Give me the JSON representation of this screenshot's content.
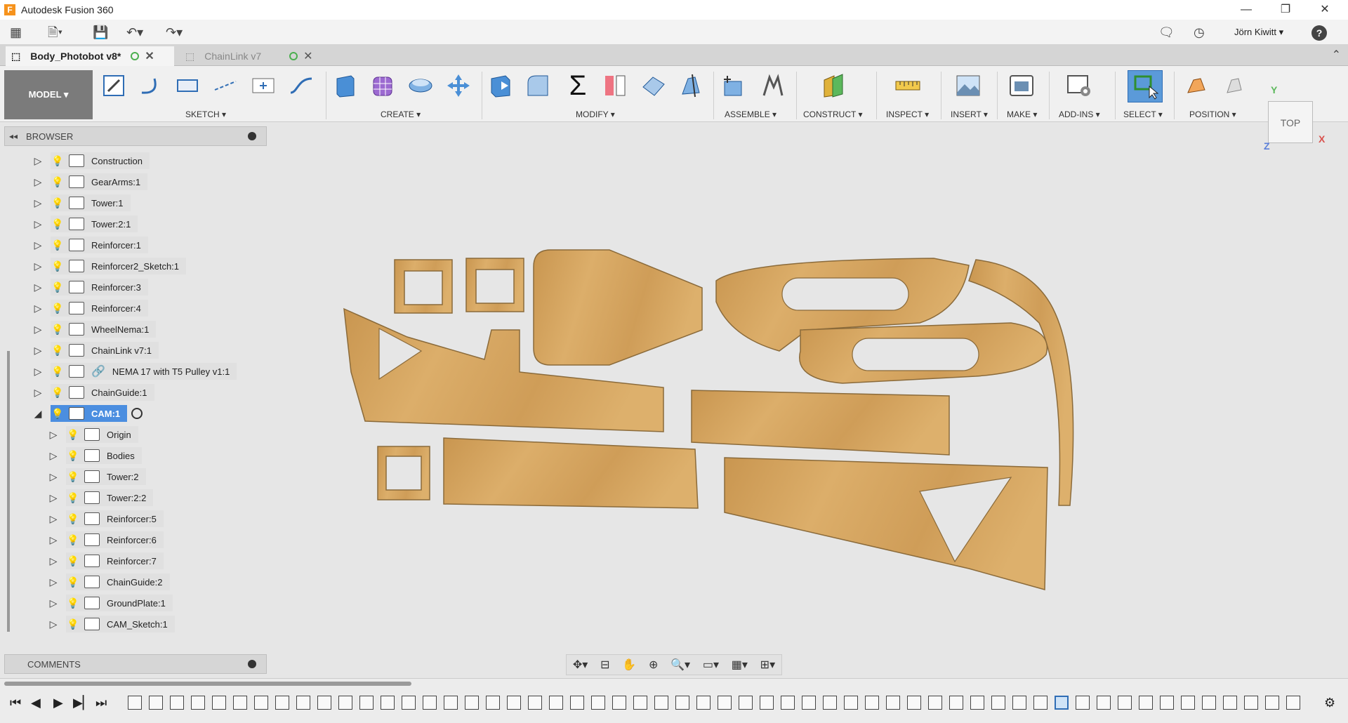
{
  "window": {
    "title": "Autodesk Fusion 360",
    "minimize": "—",
    "restore": "❐",
    "close": "✕"
  },
  "qat": {
    "user": "Jörn Kiwitt ▾",
    "help": "?"
  },
  "tabs": [
    {
      "label": "Body_Photobot v8*",
      "close": "✕"
    },
    {
      "label": "ChainLink v7",
      "close": "✕"
    }
  ],
  "ribbon": {
    "workspace": "MODEL ▾",
    "groups": [
      "SKETCH ▾",
      "CREATE ▾",
      "MODIFY ▾",
      "ASSEMBLE ▾",
      "CONSTRUCT ▾",
      "INSPECT ▾",
      "INSERT ▾",
      "MAKE ▾",
      "ADD-INS ▾",
      "SELECT ▾",
      "POSITION ▾"
    ]
  },
  "viewcube": {
    "face": "TOP",
    "axis_x": "X",
    "axis_y": "Y",
    "axis_z": "Z"
  },
  "browser": {
    "title": "BROWSER",
    "items": [
      {
        "label": "Construction"
      },
      {
        "label": "GearArms:1"
      },
      {
        "label": "Tower:1"
      },
      {
        "label": "Tower:2:1"
      },
      {
        "label": "Reinforcer:1"
      },
      {
        "label": "Reinforcer2_Sketch:1"
      },
      {
        "label": "Reinforcer:3"
      },
      {
        "label": "Reinforcer:4"
      },
      {
        "label": "WheelNema:1"
      },
      {
        "label": "ChainLink v7:1"
      },
      {
        "label": "NEMA 17 with T5 Pulley v1:1"
      },
      {
        "label": "ChainGuide:1"
      },
      {
        "label": "CAM:1"
      },
      {
        "label": "Origin"
      },
      {
        "label": "Bodies"
      },
      {
        "label": "Tower:2"
      },
      {
        "label": "Tower:2:2"
      },
      {
        "label": "Reinforcer:5"
      },
      {
        "label": "Reinforcer:6"
      },
      {
        "label": "Reinforcer:7"
      },
      {
        "label": "ChainGuide:2"
      },
      {
        "label": "GroundPlate:1"
      },
      {
        "label": "CAM_Sketch:1"
      }
    ]
  },
  "comments": {
    "title": "COMMENTS"
  },
  "colors": {
    "wood": "#d4a259",
    "wood_edge": "#8a6a3a",
    "selection": "#4b8ee0",
    "bulb_on": "#e8b52a",
    "bulb_off": "#5d8fc9"
  }
}
